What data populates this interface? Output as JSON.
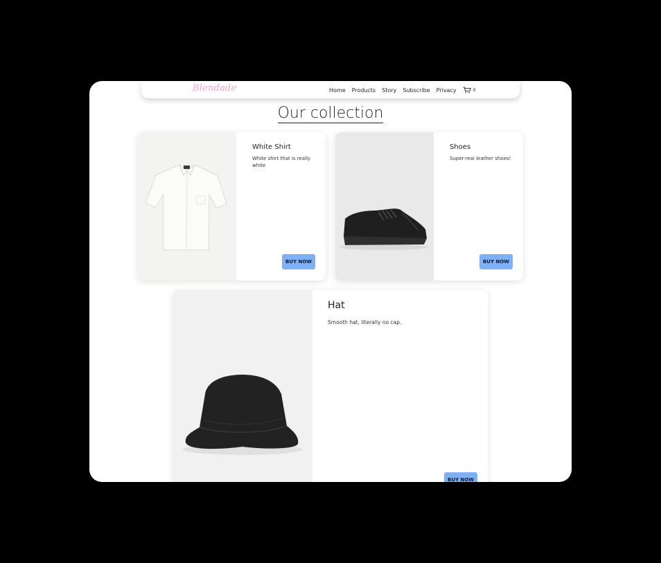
{
  "brand": {
    "logo": "Blendade"
  },
  "nav": {
    "links": [
      "Home",
      "Products",
      "Story",
      "Subscribe",
      "Privacy"
    ],
    "cart_count": "0"
  },
  "page": {
    "title": "Our collection"
  },
  "products": [
    {
      "name": "White Shirt",
      "description": "White shirt that is really white",
      "button": "BUY NOW",
      "image_icon": "shirt-image"
    },
    {
      "name": "Shoes",
      "description": "Super-real leather shoes!",
      "button": "BUY NOW",
      "image_icon": "shoe-image"
    },
    {
      "name": "Hat",
      "description": "Smooth hat, literally no cap.",
      "button": "BUY NOW",
      "image_icon": "hat-image"
    }
  ],
  "colors": {
    "logo": "#f6a3c9",
    "button": "#7fb0f5",
    "background": "#000000",
    "page": "#ffffff"
  }
}
